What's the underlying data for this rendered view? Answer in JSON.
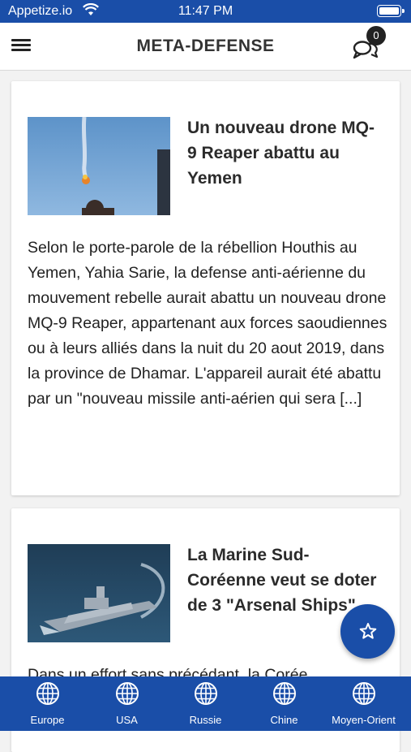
{
  "status_bar": {
    "carrier": "Appetize.io",
    "time": "11:47 PM"
  },
  "header": {
    "title": "META-DEFENSE",
    "chat_badge": "0"
  },
  "articles": [
    {
      "title": "Un nouveau drone MQ-9 Reaper abattu au Yemen",
      "excerpt": "Selon le porte-parole de la rébellion Houthis au Yemen, Yahia Sarie, la defense anti-aérienne du mouvement rebelle aurait abattu un nouveau drone MQ-9 Reaper, appartenant aux forces saoudiennes ou à leurs alliés dans la nuit du 20 aout 2019, dans la province de Dhamar. L'appareil aurait été abattu par un \"nouveau missile anti-aérien qui sera [...]"
    },
    {
      "title": "La Marine Sud-Coréenne veut se doter de 3 \"Arsenal Ships\"",
      "excerpt": "Dans un effort sans précédant, la Corée"
    }
  ],
  "tabs": [
    {
      "label": "Europe",
      "icon": "globe-icon"
    },
    {
      "label": "USA",
      "icon": "globe-icon"
    },
    {
      "label": "Russie",
      "icon": "globe-icon"
    },
    {
      "label": "Chine",
      "icon": "globe-icon"
    },
    {
      "label": "Moyen-Orient",
      "icon": "globe-icon"
    }
  ],
  "fab": {
    "icon": "star-icon"
  },
  "colors": {
    "primary": "#1a4ea8",
    "background": "#f2f2f2",
    "card": "#ffffff"
  }
}
